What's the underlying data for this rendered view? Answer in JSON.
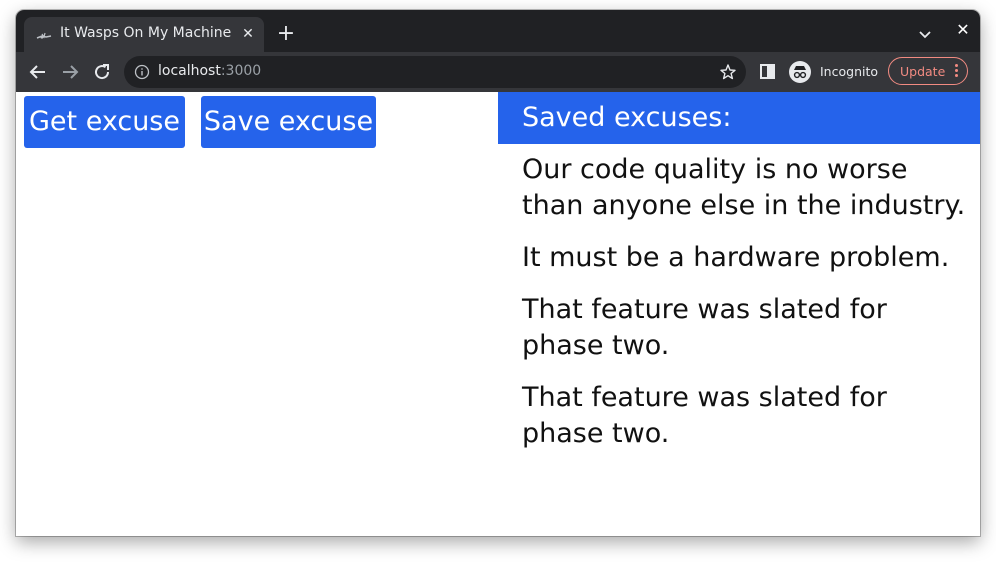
{
  "browser": {
    "tab_title": "It Wasps On My Machine",
    "url_host": "localhost",
    "url_port": ":3000",
    "incognito_label": "Incognito",
    "update_label": "Update",
    "accent_color": "#f28b82"
  },
  "page": {
    "get_excuse_label": "Get excuse",
    "save_excuse_label": "Save excuse",
    "saved_header": "Saved excuses:",
    "saved_excuses": [
      "Our code quality is no worse than anyone else in the industry.",
      "It must be a hardware problem.",
      "That feature was slated for phase two.",
      "That feature was slated for phase two."
    ],
    "primary_color": "#2563eb"
  }
}
